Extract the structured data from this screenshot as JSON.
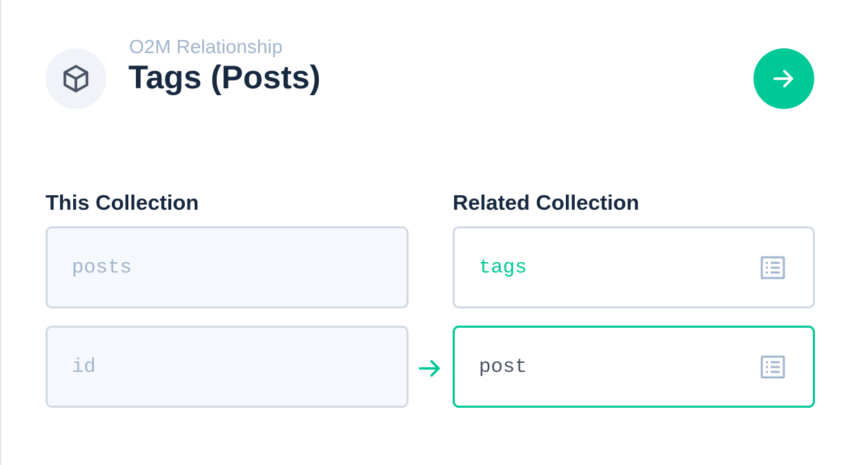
{
  "header": {
    "subtitle": "O2M Relationship",
    "title": "Tags (Posts)",
    "icon": "box-icon",
    "action_icon": "arrow-right-icon"
  },
  "this_collection": {
    "label": "This Collection",
    "collection": "posts",
    "field": "id"
  },
  "related_collection": {
    "label": "Related Collection",
    "collection": "tags",
    "field": "post",
    "picker_icon": "list-icon"
  },
  "colors": {
    "accent": "#00c897",
    "title": "#172940",
    "muted": "#a2b5cd",
    "border": "#d3dae4",
    "field_text": "#4a5365"
  }
}
